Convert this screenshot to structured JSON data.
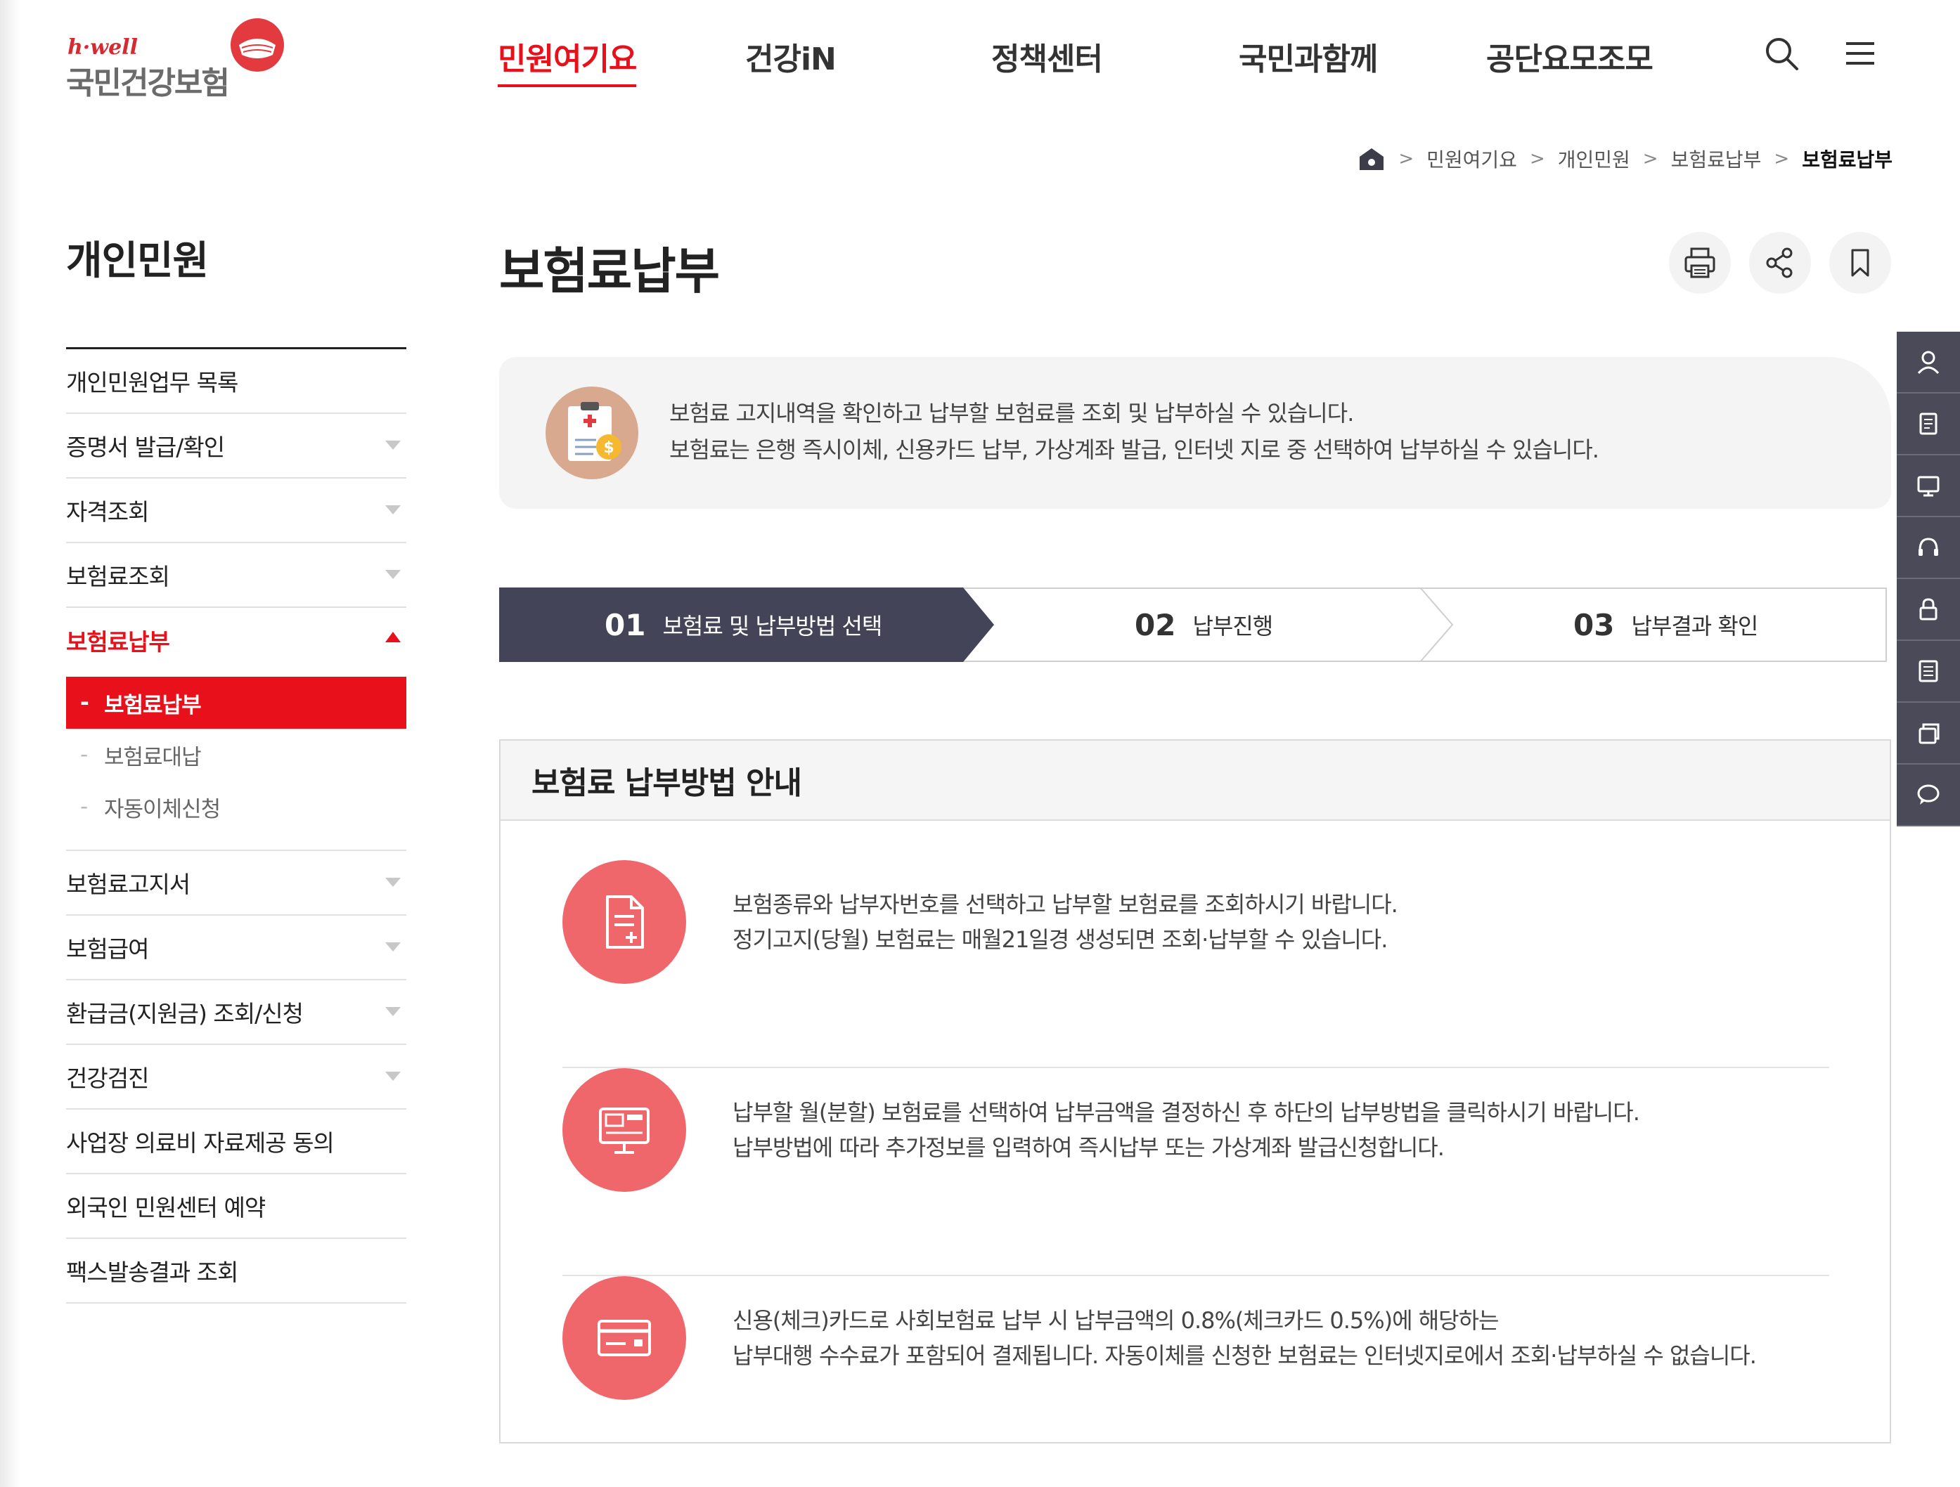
{
  "header": {
    "logo_tagline": "h·well",
    "logo_name": "국민건강보험",
    "nav": [
      {
        "label": "민원여기요",
        "active": true
      },
      {
        "label": "건강iN",
        "active": false
      },
      {
        "label": "정책센터",
        "active": false
      },
      {
        "label": "국민과함께",
        "active": false
      },
      {
        "label": "공단요모조모",
        "active": false
      }
    ],
    "icons": [
      "search-icon",
      "menu-icon"
    ]
  },
  "breadcrumb": {
    "home_icon": "home-icon",
    "items": [
      "민원여기요",
      "개인민원",
      "보험료납부"
    ],
    "current": "보험료납부"
  },
  "sidebar": {
    "title": "개인민원",
    "items": [
      {
        "label": "개인민원업무 목록",
        "has_arrow": false
      },
      {
        "label": "증명서 발급/확인",
        "has_arrow": true
      },
      {
        "label": "자격조회",
        "has_arrow": true
      },
      {
        "label": "보험료조회",
        "has_arrow": true
      },
      {
        "label": "보험료납부",
        "has_arrow": true,
        "open": true,
        "sub": [
          {
            "label": "보험료납부",
            "active": true
          },
          {
            "label": "보험료대납",
            "active": false
          },
          {
            "label": "자동이체신청",
            "active": false
          }
        ]
      },
      {
        "label": "보험료고지서",
        "has_arrow": true
      },
      {
        "label": "보험급여",
        "has_arrow": true
      },
      {
        "label": "환급금(지원금) 조회/신청",
        "has_arrow": true
      },
      {
        "label": "건강검진",
        "has_arrow": true
      },
      {
        "label": "사업장 의료비 자료제공 동의",
        "has_arrow": false
      },
      {
        "label": "외국인 민원센터 예약",
        "has_arrow": false
      },
      {
        "label": "팩스발송결과 조회",
        "has_arrow": false
      }
    ],
    "sub_dash": "-"
  },
  "page": {
    "title": "보험료납부",
    "tools": [
      "print-icon",
      "share-icon",
      "bookmark-icon"
    ]
  },
  "intro": {
    "lines": [
      "보험료 고지내역을 확인하고 납부할 보험료를 조회 및 납부하실 수 있습니다.",
      "보험료는 은행 즉시이체, 신용카드 납부, 가상계좌 발급, 인터넷 지로 중 선택하여 납부하실 수 있습니다."
    ]
  },
  "steps": [
    {
      "num": "01",
      "label": "보험료 및 납부방법 선택",
      "active": true
    },
    {
      "num": "02",
      "label": "납부진행",
      "active": false
    },
    {
      "num": "03",
      "label": "납부결과 확인",
      "active": false
    }
  ],
  "guide": {
    "title": "보험료 납부방법 안내",
    "rows": [
      {
        "icon": "document-plus-icon",
        "lines": [
          "보험종류와 납부자번호를 선택하고 납부할 보험료를 조회하시기 바랍니다.",
          "정기고지(당월) 보험료는 매월21일경 생성되면 조회·납부할 수 있습니다."
        ]
      },
      {
        "icon": "monitor-icon",
        "lines": [
          "납부할 월(분할) 보험료를 선택하여 납부금액을 결정하신 후 하단의 납부방법을 클릭하시기 바랍니다.",
          "납부방법에 따라 추가정보를 입력하여 즉시납부 또는 가상계좌 발급신청합니다."
        ]
      },
      {
        "icon": "credit-card-icon",
        "lines": [
          "신용(체크)카드로 사회보험료 납부 시 납부금액의 0.8%(체크카드 0.5%)에 해당하는",
          "납부대행 수수료가 포함되어 결제됩니다. 자동이체를 신청한 보험료는 인터넷지로에서 조회·납부하실 수 없습니다."
        ]
      }
    ]
  },
  "quick_menu": [
    "user-icon",
    "document-icon",
    "monitor-chat-icon",
    "headset-icon",
    "lock-icon",
    "list-icon",
    "stack-icon",
    "chat-icon"
  ],
  "colors": {
    "accent": "#e8101a",
    "step_active": "#434457",
    "guide_icon": "#f0676b",
    "quick_bar": "#4a4a59"
  }
}
